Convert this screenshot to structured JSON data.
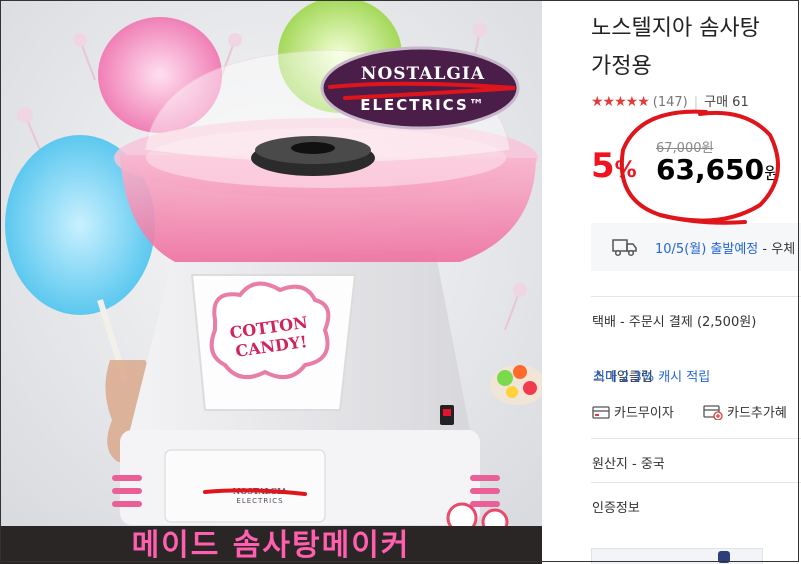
{
  "product_image": {
    "brand_top": "NOSTALGIA",
    "brand_bottom": "ELECTRICS™",
    "candy_label": "COTTON CANDY!",
    "logo_small_top": "NOSTALGIA",
    "logo_small_bottom": "ELECTRICS",
    "caption": "메이드 솜사탕메이커"
  },
  "product": {
    "title_line1": "노스텔지아 솜사탕",
    "title_line2": "가정용",
    "stars": "★★★★★",
    "review_count": "(147)",
    "purchase_count": "구매 61",
    "discount_number": "5",
    "discount_symbol": "%",
    "original_price": "67,000원",
    "sale_price": "63,650",
    "currency": "원"
  },
  "delivery": {
    "date": "10/5(월) 출발예정",
    "rest": "- 우체"
  },
  "shipping": "택배 - 주문시 결제 (2,500원)",
  "smile_club": {
    "label": "스마일클럽",
    "benefit": "최대 2.3% 캐시 적립"
  },
  "card_options": {
    "interest_free": "카드무이자",
    "additional_discount": "카드추가혜"
  },
  "origin": "원산지 - 중국",
  "certification": "인증정보",
  "icons": [
    "truck-icon",
    "card-icon",
    "card-plus-icon"
  ],
  "colors": {
    "discount_red": "#f0141e",
    "link_blue": "#2466d8",
    "annotation_red": "#e0151b"
  }
}
